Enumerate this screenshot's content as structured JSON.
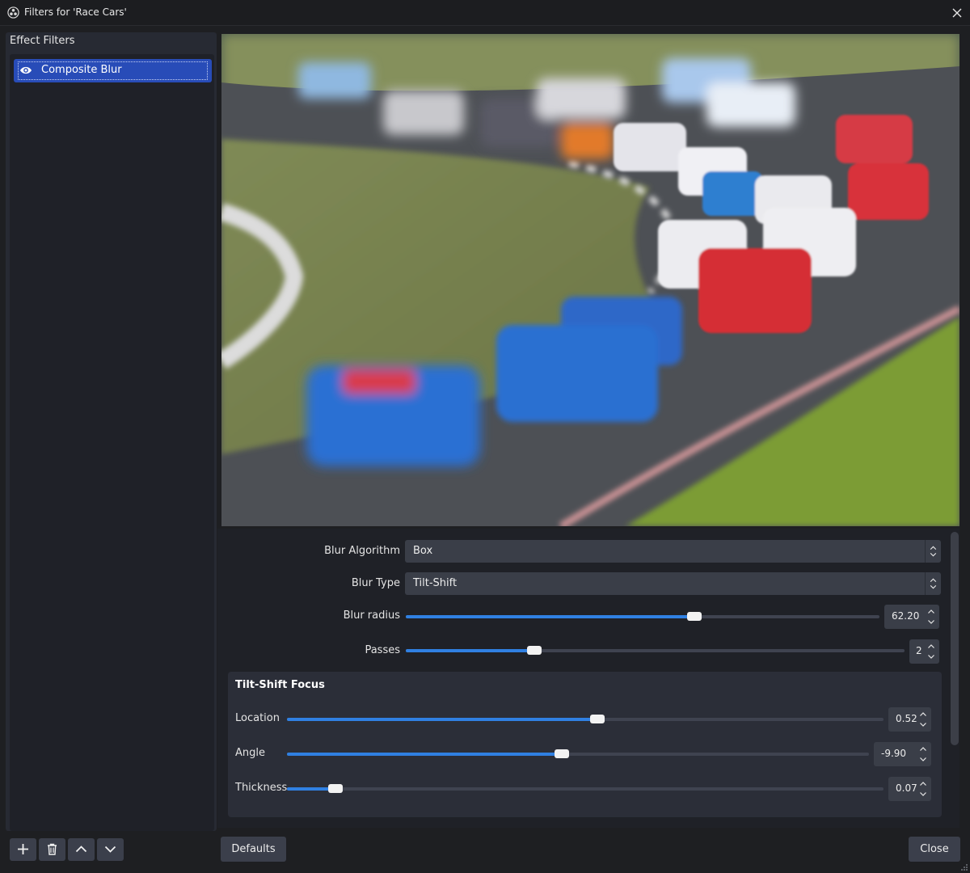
{
  "window": {
    "title": "Filters for 'Race Cars'"
  },
  "filters_panel": {
    "heading": "Effect Filters",
    "items": [
      {
        "label": "Composite Blur",
        "visible": true,
        "selected": true
      }
    ]
  },
  "toolbar": {
    "icons": [
      "plus-icon",
      "trash-icon",
      "chevron-up-icon",
      "chevron-down-icon"
    ]
  },
  "properties": {
    "blur_algorithm": {
      "label": "Blur Algorithm",
      "value": "Box"
    },
    "blur_type": {
      "label": "Blur Type",
      "value": "Tilt-Shift"
    },
    "blur_radius": {
      "label": "Blur radius",
      "value": "62.20",
      "fraction": 0.61
    },
    "passes": {
      "label": "Passes",
      "value": "2",
      "fraction": 0.258
    },
    "tilt_shift": {
      "title": "Tilt-Shift Focus",
      "location": {
        "label": "Location",
        "value": "0.52",
        "fraction": 0.52
      },
      "angle": {
        "label": "Angle",
        "value": "-9.90",
        "fraction": 0.472
      },
      "thickness": {
        "label": "Thickness",
        "value": "0.07",
        "fraction": 0.081
      }
    }
  },
  "buttons": {
    "defaults": "Defaults",
    "close": "Close"
  },
  "colors": {
    "accent": "#3080e2",
    "selection": "#284cb8",
    "background": "#1e1f22",
    "panel": "#272a33"
  }
}
